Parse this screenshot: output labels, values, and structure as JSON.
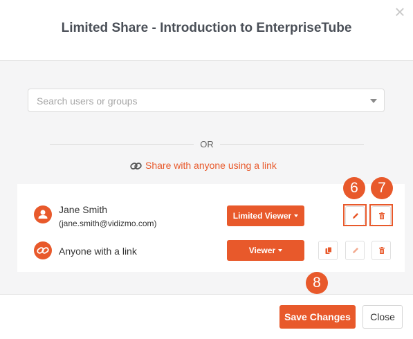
{
  "dialog": {
    "title": "Limited Share - Introduction to EnterpriseTube",
    "close_icon": "close-icon"
  },
  "search": {
    "placeholder": "Search users or groups",
    "value": ""
  },
  "divider_text": "OR",
  "share_link": {
    "label": "Share with anyone using a link",
    "icon": "link-icon"
  },
  "entries": [
    {
      "name": "Jane Smith",
      "email": "(jane.smith@vidizmo.com)",
      "icon": "user-icon",
      "role": "Limited Viewer",
      "actions": [
        "edit-icon",
        "delete-icon"
      ]
    },
    {
      "name": "Anyone with a link",
      "icon": "link-icon",
      "role": "Viewer",
      "actions": [
        "copy-icon",
        "edit-icon",
        "delete-icon"
      ]
    }
  ],
  "callouts": [
    "6",
    "7",
    "8"
  ],
  "footer": {
    "save_label": "Save Changes",
    "close_label": "Close"
  },
  "colors": {
    "accent": "#e8592b",
    "background": "#f5f5f6",
    "title_text": "#4a4f57"
  }
}
